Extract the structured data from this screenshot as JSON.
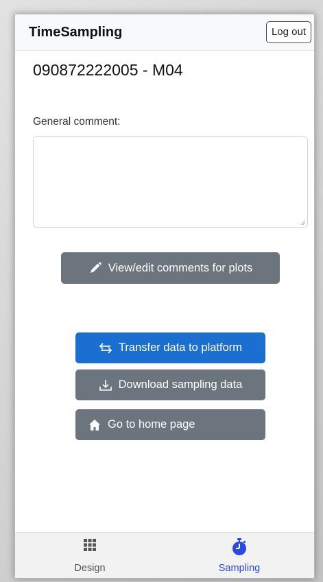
{
  "header": {
    "app_title": "TimeSampling",
    "logout_label": "Log out"
  },
  "main": {
    "page_title": "090872222005 - M04",
    "comment_label": "General comment:",
    "comment_value": "",
    "comments_button_label": "View/edit comments for plots",
    "transfer_button_label": "Transfer data to platform",
    "download_button_label": "Download sampling data",
    "home_button_label": "Go to home page"
  },
  "bottom_nav": {
    "items": [
      {
        "label": "Design",
        "icon": "grid-icon",
        "active": false,
        "color": "#555555"
      },
      {
        "label": "Sampling",
        "icon": "stopwatch-icon",
        "active": true,
        "color": "#2a47e8"
      }
    ]
  },
  "colors": {
    "primary_button": "#1a6fd0",
    "secondary_button": "#6c757d",
    "active_nav": "#2a47e8"
  }
}
